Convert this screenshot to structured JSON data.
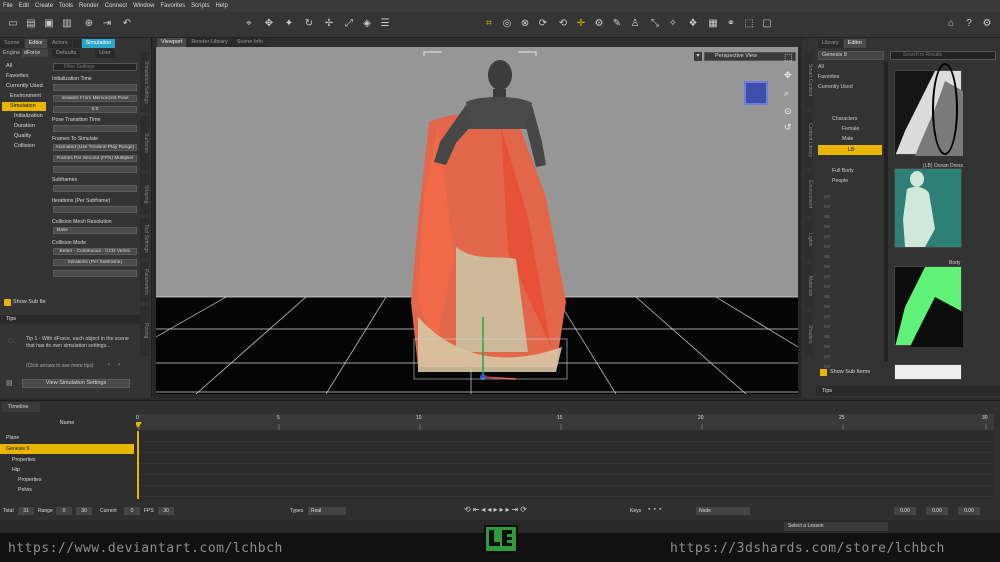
{
  "menu": [
    "File",
    "Edit",
    "Create",
    "Tools",
    "Render",
    "Connect",
    "Window",
    "Favorites",
    "Scripts",
    "Help"
  ],
  "left_panel": {
    "tabs": [
      "Scene",
      "Editor",
      "Actors",
      "",
      "Simulation"
    ],
    "engine_label": "Engine",
    "engine_value": "dForce",
    "sub_tabs": [
      "Defaults",
      "User"
    ],
    "filter_placeholder": "Filter Settings",
    "categories": [
      "All",
      "Favorites",
      "Currently Used",
      "Environment",
      "Simulation",
      "Initialization",
      "Duration",
      "Quality",
      "Collision"
    ],
    "properties": [
      {
        "label": "Initialization Time",
        "control": ""
      },
      {
        "label": "",
        "control": "Initialize From Memorized Pose"
      },
      {
        "label": "",
        "control": "0.0"
      },
      {
        "label": "Pose Transition Time",
        "control": ""
      },
      {
        "label": "Frames To Simulate",
        "control": "Animated (Use Timeline Play Range)"
      },
      {
        "label": "",
        "control": "Frames Per Second (FPS) Multiplier"
      },
      {
        "label": "Subframes",
        "control": ""
      },
      {
        "label": "Iterations (Per Subframe)",
        "control": ""
      },
      {
        "label": "Collision Mesh Resolution",
        "control": "Base"
      },
      {
        "label": "Collision Mode",
        "control": "Better - Continuous - CCD Vertex"
      },
      {
        "label": "",
        "control": "Iterations (Per Subframe)"
      }
    ],
    "show_sub_items": "Show Sub Ite",
    "vtabs": [
      "Simulation Settings",
      "Surfaces",
      "Shaping",
      "Tool Settings",
      "Parameters",
      "Posing"
    ],
    "tips_title": "Tips",
    "tips_text": "Tip 1 - With dForce, each object in the scene that has its own simulation settings...",
    "tips_nav": "(Click arrows to see more tips)",
    "tips_button": "View Simulation Settings"
  },
  "viewport": {
    "tabs": [
      "Viewport",
      "Render Library",
      "Scene Info"
    ],
    "view_label": "Perspective View"
  },
  "right_panel": {
    "tabs": [
      "Library",
      "Editor"
    ],
    "dropdown_value": "Genesis 9",
    "search_placeholder": "Search in Results",
    "categories": [
      "All",
      "Favorites",
      "Currently Used"
    ],
    "tree": [
      "Characters",
      "Female",
      "Male",
      "LB",
      "Full Body",
      "People"
    ],
    "thumb_labels": [
      "(LB) Ocean Dress",
      "Body"
    ],
    "show_sub_items": "Show Sub Items",
    "tips": "Tips",
    "vtabs": [
      "Smart Content",
      "Content Library",
      "Environment",
      "Lights",
      "Materials",
      "Shaders"
    ]
  },
  "timeline": {
    "title": "Timeline",
    "name_header": "Name",
    "ruler": [
      "0",
      "5",
      "10",
      "15",
      "20",
      "25",
      "30"
    ],
    "rows": [
      "Plane",
      "Genesis 9",
      "Properties",
      "Hip",
      "Properties",
      "Pelvis"
    ],
    "controls": {
      "total_label": "Total",
      "total_value": "31",
      "range_label": "Range",
      "range_start": "0",
      "range_end": "30",
      "current_label": "Current",
      "current_value": "0",
      "fps_label": "FPS",
      "fps_value": "30",
      "types_label": "Types",
      "types_value": "Real",
      "keys_label": "Keys",
      "keys_value": "Node",
      "v1": "0.00",
      "v2": "0.00",
      "v3": "0.00"
    },
    "layer_select": "Select a Lesson"
  },
  "footer": {
    "left_url": "https://www.deviantart.com/lchbch",
    "right_url": "https://3dshards.com/store/lchbch"
  },
  "colors": {
    "accent": "#e8b600",
    "tab_highlight": "#2aa6c8",
    "dress": "#e05a3a",
    "logo": "#2f9b3a"
  }
}
